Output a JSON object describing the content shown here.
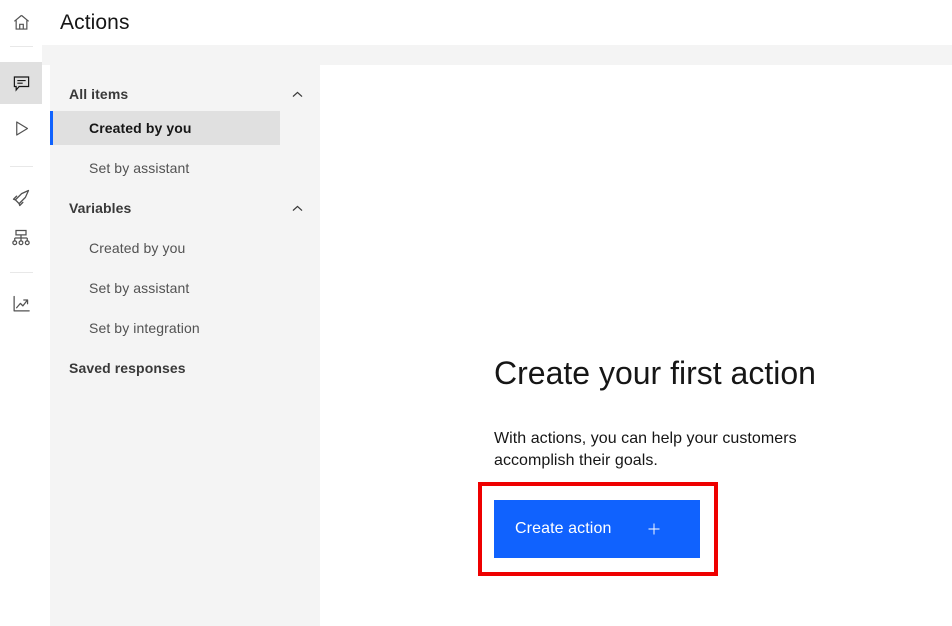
{
  "header": {
    "title": "Actions",
    "home_icon": "home-icon"
  },
  "icon_rail": {
    "items": [
      {
        "name": "home-icon",
        "label": "Home",
        "active": false
      },
      {
        "name": "chat-icon",
        "label": "Assistant",
        "active": true
      },
      {
        "name": "play-icon",
        "label": "Preview",
        "active": false
      },
      {
        "name": "rocket-icon",
        "label": "Publish",
        "active": false
      },
      {
        "name": "sitemap-icon",
        "label": "Integrations",
        "active": false
      },
      {
        "name": "analytics-icon",
        "label": "Analytics",
        "active": false
      }
    ]
  },
  "sidebar": {
    "groups": [
      {
        "title": "All items",
        "chevron": "chevron-up-icon",
        "items": [
          {
            "label": "Created by you",
            "selected": true
          },
          {
            "label": "Set by assistant",
            "selected": false
          }
        ]
      },
      {
        "title": "Variables",
        "chevron": "chevron-up-icon",
        "items": [
          {
            "label": "Created by you",
            "selected": false
          },
          {
            "label": "Set by assistant",
            "selected": false
          },
          {
            "label": "Set by integration",
            "selected": false
          }
        ]
      }
    ],
    "saved_responses_label": "Saved responses"
  },
  "empty_state": {
    "heading": "Create your first action",
    "body": "With actions, you can help your customers accomplish their goals.",
    "button_label": "Create action",
    "button_icon": "plus-icon"
  },
  "colors": {
    "accent_blue": "#1062fe",
    "selection_blue": "#0f62fe",
    "highlight_red": "#ee0000",
    "panel_gray": "#f4f4f4",
    "selected_gray": "#e0e0e0"
  }
}
